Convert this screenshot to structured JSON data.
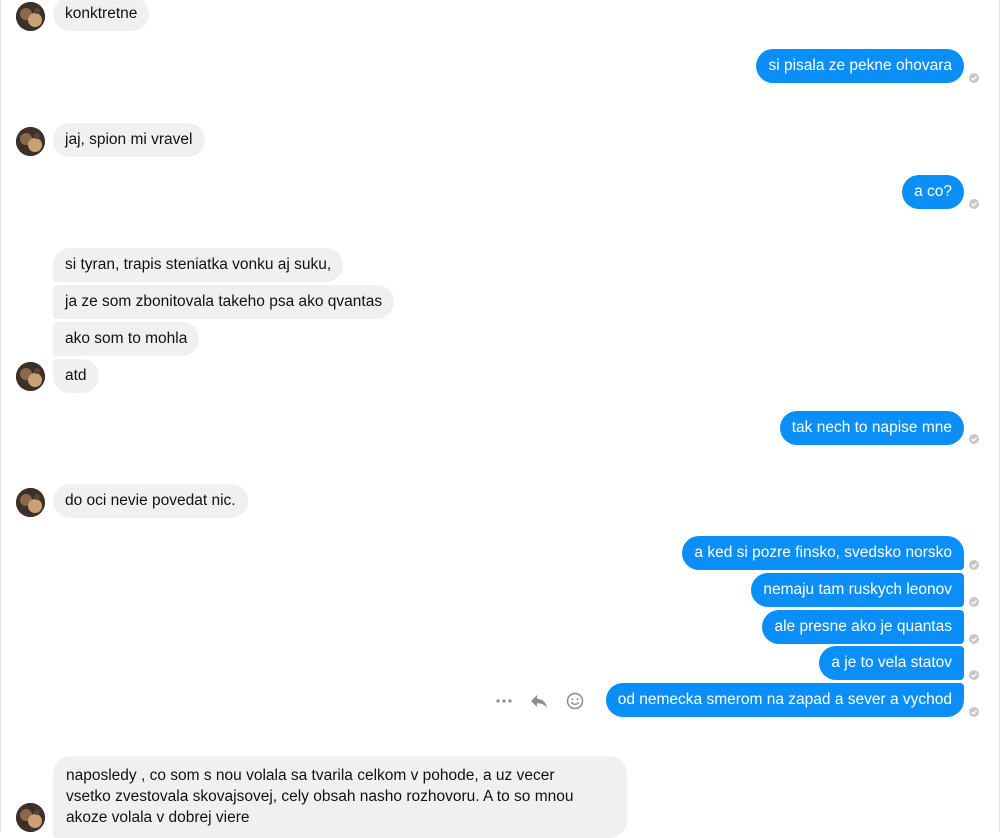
{
  "conversation": {
    "messages": [
      {
        "id": "m1",
        "direction": "in",
        "text": "konktretne"
      },
      {
        "id": "m2",
        "direction": "out",
        "text": "si pisala ze pekne ohovara"
      },
      {
        "id": "m3",
        "direction": "in",
        "text": "jaj, spion mi vravel"
      },
      {
        "id": "m4",
        "direction": "out",
        "text": "a co?"
      },
      {
        "id": "m5",
        "direction": "in",
        "text": "si tyran, trapis steniatka vonku aj suku,"
      },
      {
        "id": "m6",
        "direction": "in",
        "text": "ja ze som zbonitovala takeho psa ako qvantas"
      },
      {
        "id": "m7",
        "direction": "in",
        "text": "ako som to mohla"
      },
      {
        "id": "m8",
        "direction": "in",
        "text": "atd"
      },
      {
        "id": "m9",
        "direction": "out",
        "text": "tak nech to napise mne"
      },
      {
        "id": "m10",
        "direction": "in",
        "text": "do oci nevie povedat nic."
      },
      {
        "id": "m11",
        "direction": "out",
        "text": "a ked si pozre finsko, svedsko norsko"
      },
      {
        "id": "m12",
        "direction": "out",
        "text": "nemaju tam ruskych leonov"
      },
      {
        "id": "m13",
        "direction": "out",
        "text": "ale presne ako je quantas"
      },
      {
        "id": "m14",
        "direction": "out",
        "text": "a je to vela statov"
      },
      {
        "id": "m15",
        "direction": "out",
        "text": "od nemecka smerom na zapad a sever a vychod"
      },
      {
        "id": "m16",
        "direction": "in",
        "text": "naposledy , co som s nou volala sa tvarila celkom v pohode, a uz vecer\nvsetko zvestovala skovajsovej, cely obsah nasho rozhovoru. A to so mnou\nakoze volala v dobrej viere"
      }
    ]
  },
  "message_actions": {
    "icons": [
      "more-icon",
      "reply-icon",
      "emoji-icon"
    ]
  },
  "colors": {
    "outgoing_bubble": "#0a8ef7",
    "incoming_bubble": "#f1f0f0",
    "seen_indicator": "#c8c8c8"
  }
}
